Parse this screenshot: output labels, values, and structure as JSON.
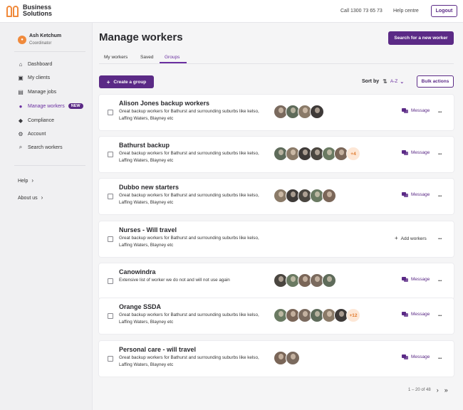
{
  "header": {
    "brand_line1": "Business",
    "brand_line2": "Solutions",
    "call_label": "Call 1300 73 65 73",
    "help_centre": "Help centre",
    "logout": "Logout"
  },
  "user": {
    "name": "Ash Ketchum",
    "role": "Coordinator",
    "avatar_icon": "person-icon"
  },
  "nav": [
    {
      "label": "Dashboard",
      "icon": "home-icon"
    },
    {
      "label": "My clients",
      "icon": "clients-icon"
    },
    {
      "label": "Manage jobs",
      "icon": "clipboard-icon"
    },
    {
      "label": "Manage workers",
      "icon": "workers-icon",
      "badge": "NEW",
      "active": true
    },
    {
      "label": "Compliance",
      "icon": "shield-icon"
    },
    {
      "label": "Account",
      "icon": "gear-icon"
    },
    {
      "label": "Search workers",
      "icon": "search-icon"
    }
  ],
  "side_links": {
    "help": "Help",
    "about": "About us"
  },
  "main": {
    "title": "Manage workers",
    "search_button": "Search for a new worker",
    "tabs": [
      "My workers",
      "Saved",
      "Groups"
    ],
    "active_tab": "Groups",
    "create_button": "Create a group",
    "sort_label": "Sort by",
    "sort_value": "A-Z",
    "bulk_button": "Bulk actions"
  },
  "groups": [
    {
      "name": "Alison Jones backup workers",
      "desc": "Great backup workers for Bathurst and surrounding suburbs like kelso, Laffing Waters, Blayney etc",
      "avatars": 4,
      "more": "",
      "action": "Message"
    },
    {
      "name": "Bathurst backup",
      "desc": "Great backup workers for Bathurst and surrounding suburbs like kelso, Laffing Waters, Blayney etc",
      "avatars": 6,
      "more": "+4",
      "action": "Message"
    },
    {
      "name": "Dubbo new starters",
      "desc": "Great backup workers for Bathurst and surrounding suburbs like kelso, Laffing Waters, Blayney etc",
      "avatars": 5,
      "more": "",
      "action": "Message"
    },
    {
      "name": "Nurses - Will travel",
      "desc": "Great backup workers for Bathurst and surrounding suburbs like kelso, Laffing Waters, Blayney etc",
      "avatars": 0,
      "more": "",
      "action": "Add workers"
    },
    {
      "name": "Canowindra",
      "desc": "Extensive list of worker we do not and will not use again",
      "avatars": 5,
      "more": "",
      "action": "Message"
    },
    {
      "name": "Orange SSDA",
      "desc": "Great backup workers for Bathurst and surrounding suburbs like kelso, Laffing Waters, Blayney etc",
      "avatars": 6,
      "more": "+12",
      "action": "Message"
    },
    {
      "name": "Personal care - will travel",
      "desc": "Great backup workers for Bathurst and surrounding suburbs like kelso, Laffing Waters, Blayney etc",
      "avatars": 2,
      "more": "",
      "action": "Message"
    }
  ],
  "pagination": {
    "range": "1 – 20 of 48"
  },
  "colors": {
    "accent": "#5b2a86",
    "brand": "#f08a3c"
  }
}
